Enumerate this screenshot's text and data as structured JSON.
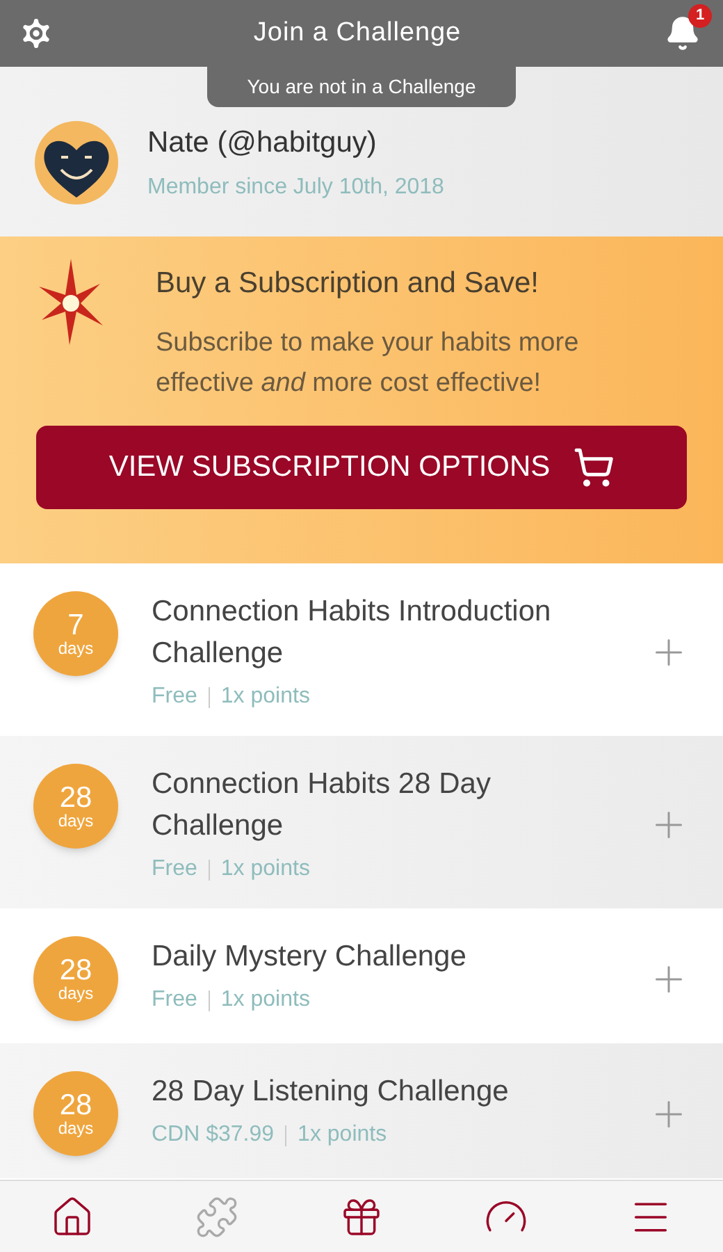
{
  "header": {
    "title": "Join a Challenge",
    "notification_count": "1",
    "status_tab": "You are not in a Challenge"
  },
  "profile": {
    "name": "Nate (@habitguy)",
    "member_since": "Member since July 10th, 2018"
  },
  "promo": {
    "title": "Buy a Subscription and Save!",
    "body": "Subscribe to make your habits more effective *and* more cost effective!",
    "button": "VIEW SUBSCRIPTION OPTIONS"
  },
  "challenges": [
    {
      "days": "7",
      "unit": "days",
      "title": "Connection Habits Introduction Challenge",
      "price": "Free",
      "points": "1x points"
    },
    {
      "days": "28",
      "unit": "days",
      "title": "Connection Habits 28 Day Challenge",
      "price": "Free",
      "points": "1x points"
    },
    {
      "days": "28",
      "unit": "days",
      "title": "Daily Mystery Challenge",
      "price": "Free",
      "points": "1x points"
    },
    {
      "days": "28",
      "unit": "days",
      "title": "28 Day Listening Challenge",
      "price": "CDN $37.99",
      "points": "1x points"
    }
  ],
  "bottom_nav": [
    {
      "kind": "home",
      "disabled": false
    },
    {
      "kind": "puzzle",
      "disabled": true
    },
    {
      "kind": "gift",
      "disabled": false
    },
    {
      "kind": "gauge",
      "disabled": false
    },
    {
      "kind": "menu",
      "disabled": false
    }
  ]
}
